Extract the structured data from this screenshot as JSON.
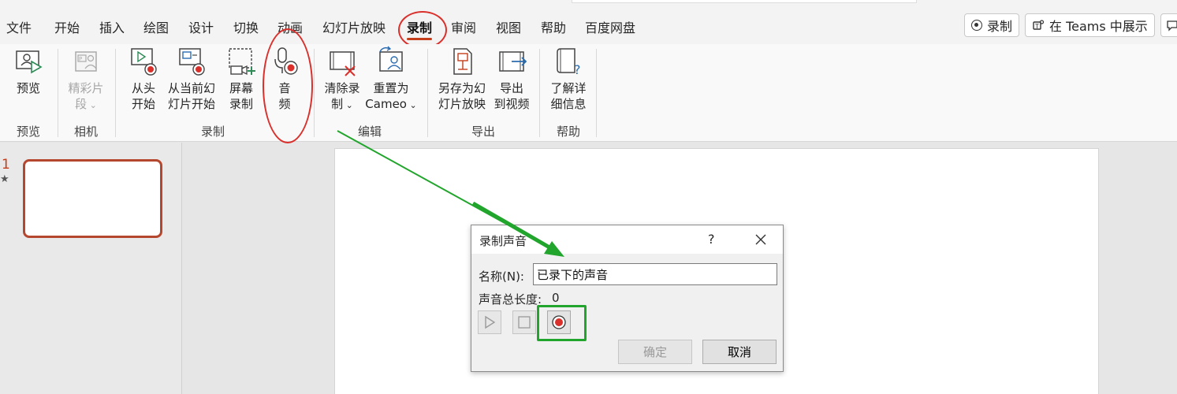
{
  "menu": {
    "tabs": [
      "文件",
      "开始",
      "插入",
      "绘图",
      "设计",
      "切换",
      "动画",
      "幻灯片放映",
      "录制",
      "审阅",
      "视图",
      "帮助",
      "百度网盘"
    ],
    "active_tab": "录制",
    "record_button": "录制",
    "teams_button": "在 Teams 中展示"
  },
  "ribbon": {
    "preview_btn": "预览",
    "camera_btn_line1": "精彩片",
    "camera_btn_line2": "段",
    "record_from_start_line1": "从头",
    "record_from_start_line2": "开始",
    "record_from_current_line1": "从当前幻",
    "record_from_current_line2": "灯片开始",
    "screen_record_line1": "屏幕",
    "screen_record_line2": "录制",
    "audio_line1": "音",
    "audio_line2": "频",
    "clear_line1": "清除录",
    "clear_line2": "制",
    "reset_line1": "重置为",
    "reset_line2": "Cameo",
    "save_show_line1": "另存为幻",
    "save_show_line2": "灯片放映",
    "export_video_line1": "导出",
    "export_video_line2": "到视频",
    "learn_more_line1": "了解详",
    "learn_more_line2": "细信息",
    "groups": {
      "preview": "预览",
      "camera": "相机",
      "record": "录制",
      "edit": "编辑",
      "export": "导出",
      "help": "帮助"
    }
  },
  "slides": {
    "number": "1",
    "star": "★"
  },
  "dialog": {
    "title": "录制声音",
    "help": "?",
    "name_label": "名称(N):",
    "name_value": "已录下的声音",
    "length_label": "声音总长度:",
    "length_value": "0",
    "ok_label": "确定",
    "cancel_label": "取消"
  },
  "colors": {
    "accent": "#c43e1c",
    "annotation_red": "#d9302c",
    "annotation_green": "#22a52c"
  }
}
